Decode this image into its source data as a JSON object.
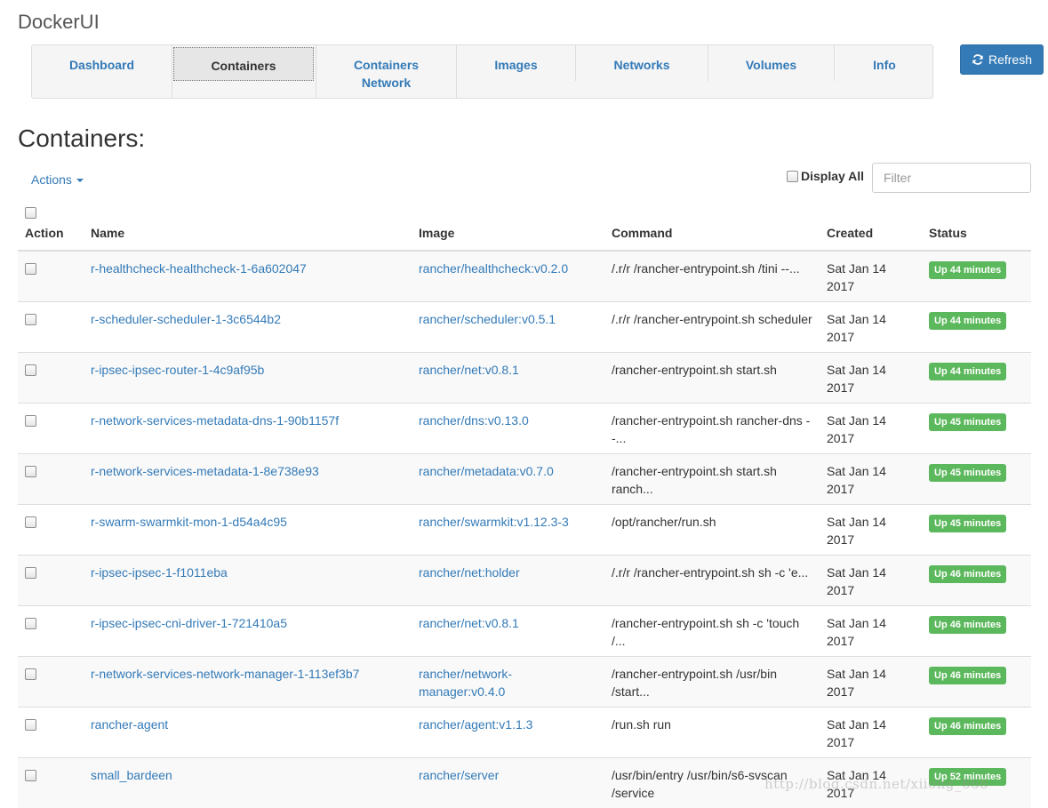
{
  "app": {
    "title": "DockerUI"
  },
  "nav": {
    "tabs": [
      {
        "label_line1": "Dashboard",
        "label_line2": ""
      },
      {
        "label_line1": "Containers",
        "label_line2": ""
      },
      {
        "label_line1": "Containers",
        "label_line2": "Network"
      },
      {
        "label_line1": "Images",
        "label_line2": ""
      },
      {
        "label_line1": "Networks",
        "label_line2": ""
      },
      {
        "label_line1": "Volumes",
        "label_line2": ""
      },
      {
        "label_line1": "Info",
        "label_line2": ""
      }
    ],
    "active_tab": "Containers",
    "refresh_label": "Refresh"
  },
  "page": {
    "title": "Containers:",
    "actions_label": "Actions",
    "display_all_label": "Display All",
    "filter_placeholder": "Filter"
  },
  "table": {
    "headers": {
      "action": "Action",
      "name": "Name",
      "image": "Image",
      "command": "Command",
      "created": "Created",
      "status": "Status"
    },
    "rows": [
      {
        "name": "r-healthcheck-healthcheck-1-6a602047",
        "image": "rancher/healthcheck:v0.2.0",
        "command": "/.r/r /rancher-entrypoint.sh /tini --...",
        "created": "Sat Jan 14 2017",
        "status": "Up 44 minutes"
      },
      {
        "name": "r-scheduler-scheduler-1-3c6544b2",
        "image": "rancher/scheduler:v0.5.1",
        "command": "/.r/r /rancher-entrypoint.sh scheduler",
        "created": "Sat Jan 14 2017",
        "status": "Up 44 minutes"
      },
      {
        "name": "r-ipsec-ipsec-router-1-4c9af95b",
        "image": "rancher/net:v0.8.1",
        "command": "/rancher-entrypoint.sh start.sh",
        "created": "Sat Jan 14 2017",
        "status": "Up 44 minutes"
      },
      {
        "name": "r-network-services-metadata-dns-1-90b1157f",
        "image": "rancher/dns:v0.13.0",
        "command": "/rancher-entrypoint.sh rancher-dns --...",
        "created": "Sat Jan 14 2017",
        "status": "Up 45 minutes"
      },
      {
        "name": "r-network-services-metadata-1-8e738e93",
        "image": "rancher/metadata:v0.7.0",
        "command": "/rancher-entrypoint.sh start.sh ranch...",
        "created": "Sat Jan 14 2017",
        "status": "Up 45 minutes"
      },
      {
        "name": "r-swarm-swarmkit-mon-1-d54a4c95",
        "image": "rancher/swarmkit:v1.12.3-3",
        "command": "/opt/rancher/run.sh",
        "created": "Sat Jan 14 2017",
        "status": "Up 45 minutes"
      },
      {
        "name": "r-ipsec-ipsec-1-f1011eba",
        "image": "rancher/net:holder",
        "command": "/.r/r /rancher-entrypoint.sh sh -c 'e...",
        "created": "Sat Jan 14 2017",
        "status": "Up 46 minutes"
      },
      {
        "name": "r-ipsec-ipsec-cni-driver-1-721410a5",
        "image": "rancher/net:v0.8.1",
        "command": "/rancher-entrypoint.sh sh -c 'touch /...",
        "created": "Sat Jan 14 2017",
        "status": "Up 46 minutes"
      },
      {
        "name": "r-network-services-network-manager-1-113ef3b7",
        "image": "rancher/network-manager:v0.4.0",
        "command": "/rancher-entrypoint.sh /usr/bin /start...",
        "created": "Sat Jan 14 2017",
        "status": "Up 46 minutes"
      },
      {
        "name": "rancher-agent",
        "image": "rancher/agent:v1.1.3",
        "command": "/run.sh run",
        "created": "Sat Jan 14 2017",
        "status": "Up 46 minutes"
      },
      {
        "name": "small_bardeen",
        "image": "rancher/server",
        "command": "/usr/bin/entry /usr/bin/s6-svscan /service",
        "created": "Sat Jan 14 2017",
        "status": "Up 52 minutes"
      }
    ]
  },
  "watermark": "http://blog.csdn.net/xiiong_666",
  "colors": {
    "link": "#337ab7",
    "primary_button": "#337ab7",
    "status_success": "#5cb85c"
  }
}
